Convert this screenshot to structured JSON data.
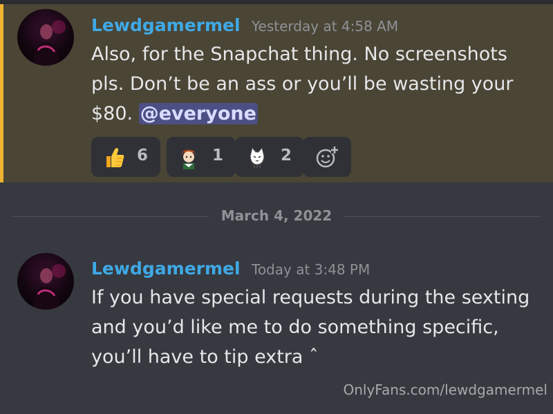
{
  "messages": [
    {
      "username": "Lewdgamermel",
      "timestamp": "Yesterday at 4:58 AM",
      "lines": [
        "Also, for the Snapchat thing. No screenshots",
        "pls. Don’t be an ass or you’ll be wasting your",
        "$80. "
      ],
      "mention": "@everyone",
      "highlighted": true,
      "reactions": [
        {
          "emoji": "thumbs-up",
          "count": "6"
        },
        {
          "emoji": "anime-character-sticker",
          "count": "1"
        },
        {
          "emoji": "white-cat-sticker",
          "count": "2"
        }
      ]
    },
    {
      "username": "Lewdgamermel",
      "timestamp": "Today at 3:48 PM",
      "lines": [
        "If you have special requests during the sexting",
        "and you’d like me to do something specific,",
        "you’ll have to tip extra ˆ"
      ]
    }
  ],
  "date_divider": "March 4, 2022",
  "watermark": "OnlyFans.com/lewdgamermel",
  "colors": {
    "background": "#36393f",
    "highlight": "#4a4535",
    "mention_bar": "#f0b232",
    "username": "#3fa9e6",
    "mention_bg": "#4c4f84"
  }
}
